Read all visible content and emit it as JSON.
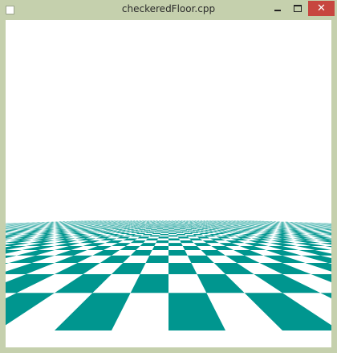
{
  "window": {
    "title": "checkeredFloor.cpp",
    "buttons": {
      "minimize_icon": "minimize-icon",
      "maximize_icon": "maximize-icon",
      "close_label": "✕"
    }
  },
  "scene": {
    "background_color": "#ffffff",
    "tile_color": "#00968f",
    "alt_tile_color": "#ffffff",
    "pattern": "checkerboard"
  }
}
